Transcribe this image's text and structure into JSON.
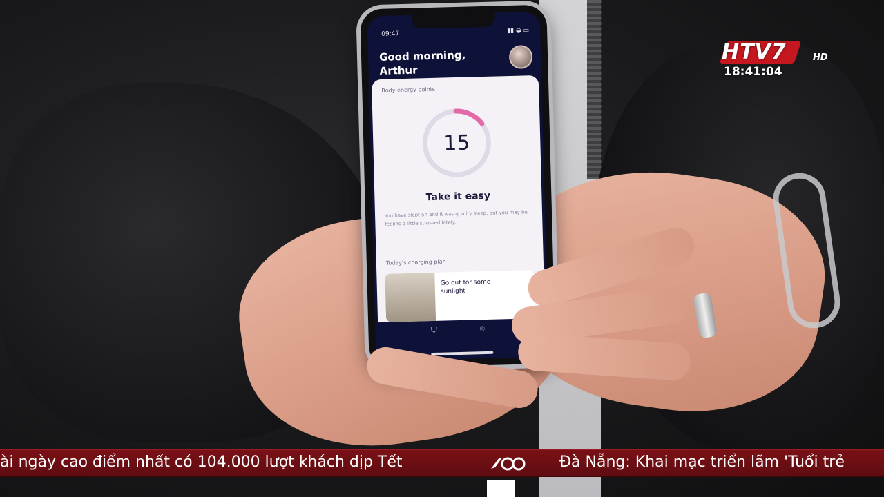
{
  "broadcast": {
    "channel_logo": "HTV7",
    "channel_logo_suffix": "HD",
    "clock": "18:41:04",
    "ticker_left": "ài ngày cao điểm nhất có 104.000 lượt khách dịp Tết",
    "ticker_right": "Đà Nẵng: Khai mạc triển lãm 'Tuổi trẻ",
    "colors": {
      "ticker": "#6a0f14",
      "logo_red": "#c5171f"
    }
  },
  "phone": {
    "status_time": "09:47",
    "greeting": "Good morning, Arthur",
    "card_label": "Body energy points",
    "gauge_value": "15",
    "gauge_fraction": 0.15,
    "headline": "Take it easy",
    "description": "You have slept 5h and it was quality sleep, but you may be feeling a little stressed lately.",
    "section_label": "Today's charging plan",
    "plan_title": "Go out for some sunlight",
    "colors": {
      "screen_bg": "#0e1138",
      "card_bg": "#f4f2f6",
      "gauge_arc": "#e36aa8"
    }
  }
}
